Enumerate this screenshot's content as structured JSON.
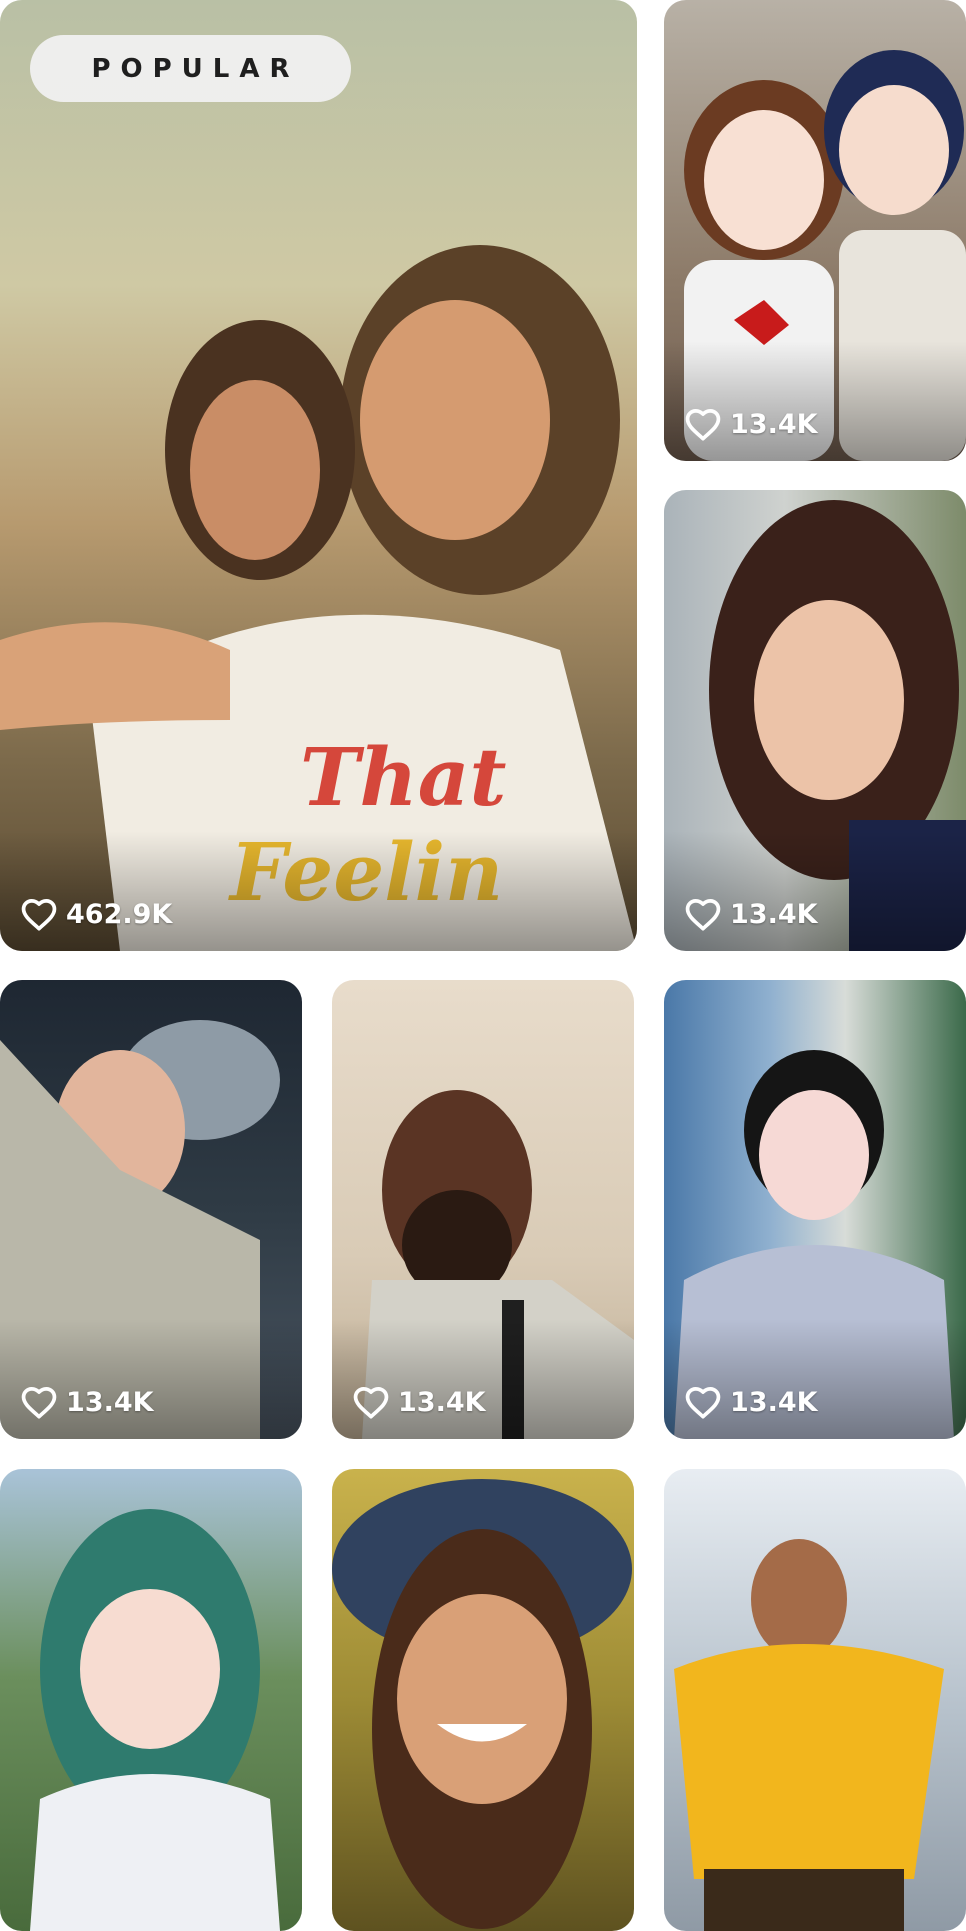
{
  "featured": {
    "badge": "POPULAR",
    "likes": "462.9K"
  },
  "cards": [
    {
      "likes": "13.4K"
    },
    {
      "likes": "13.4K"
    },
    {
      "likes": "13.4K"
    },
    {
      "likes": "13.4K"
    },
    {
      "likes": "13.4K"
    }
  ],
  "icons": {
    "like": "heart-outline-icon"
  },
  "colors": {
    "badge_bg": "#f0f0f0",
    "badge_text": "#1f1f1f",
    "like_text": "#ffffff"
  }
}
